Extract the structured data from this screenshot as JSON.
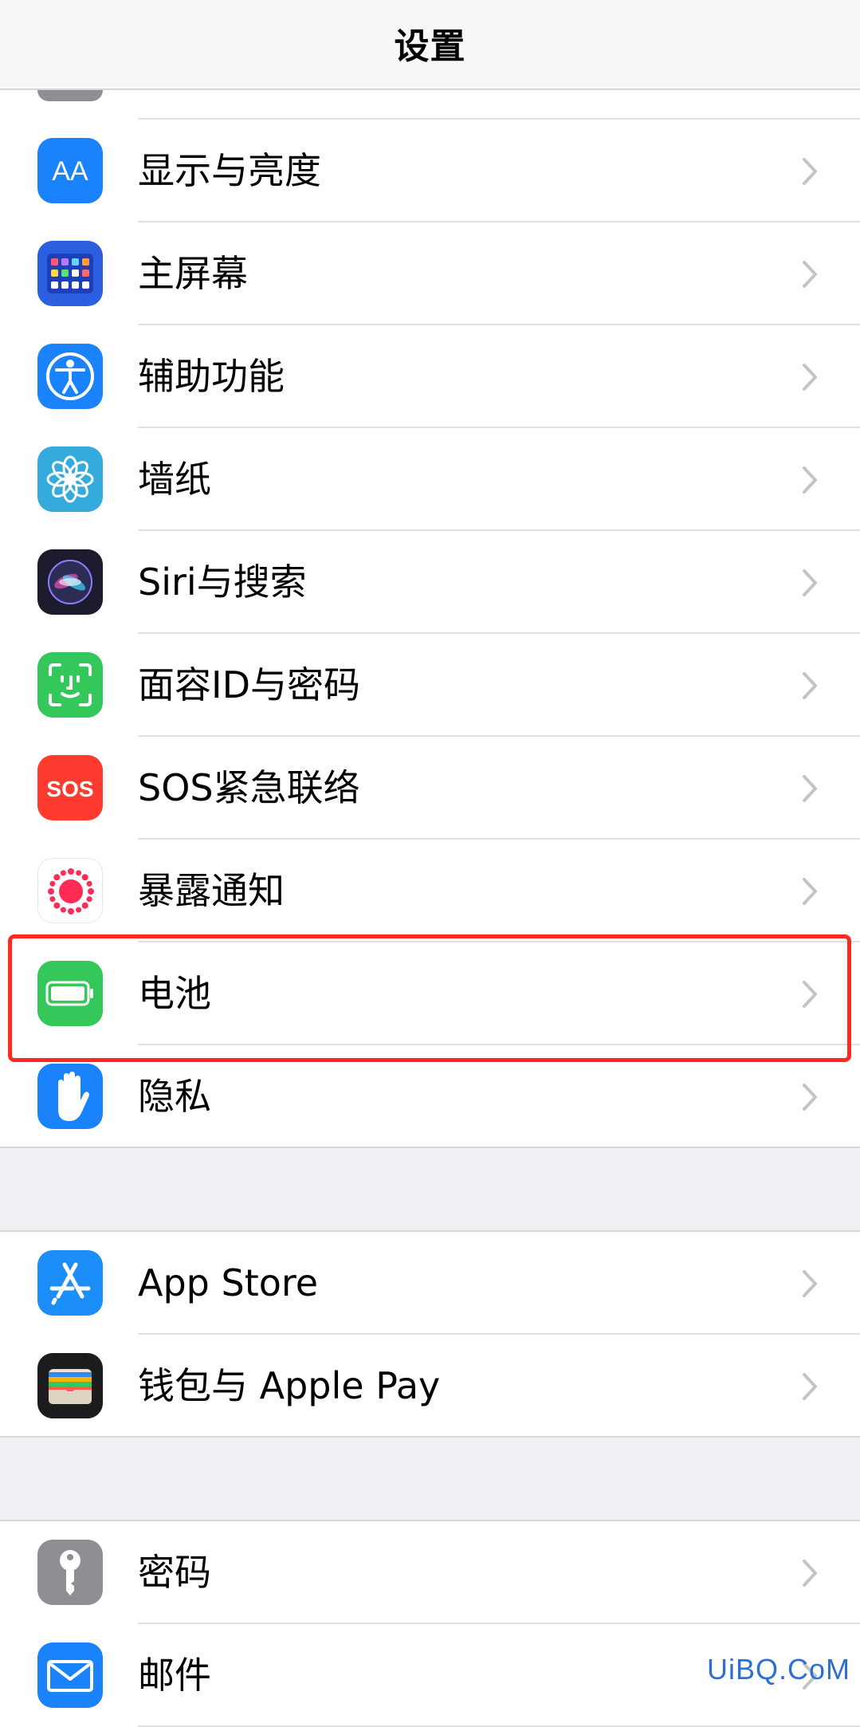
{
  "nav": {
    "title": "设置"
  },
  "groups": [
    {
      "rows": [
        {
          "label": "显示与亮度",
          "icon": "display-brightness-icon"
        },
        {
          "label": "主屏幕",
          "icon": "home-screen-icon"
        },
        {
          "label": "辅助功能",
          "icon": "accessibility-icon"
        },
        {
          "label": "墙纸",
          "icon": "wallpaper-icon"
        },
        {
          "label": "Siri与搜索",
          "icon": "siri-icon"
        },
        {
          "label": "面容ID与密码",
          "icon": "face-id-icon"
        },
        {
          "label": "SOS紧急联络",
          "icon": "sos-icon"
        },
        {
          "label": "暴露通知",
          "icon": "exposure-notification-icon"
        },
        {
          "label": "电池",
          "icon": "battery-icon"
        },
        {
          "label": "隐私",
          "icon": "privacy-hand-icon"
        }
      ]
    },
    {
      "rows": [
        {
          "label": "App Store",
          "icon": "app-store-icon"
        },
        {
          "label": "钱包与 Apple Pay",
          "icon": "wallet-icon"
        }
      ]
    },
    {
      "rows": [
        {
          "label": "密码",
          "icon": "passwords-key-icon"
        },
        {
          "label": "邮件",
          "icon": "mail-icon"
        }
      ]
    }
  ],
  "icon_text": {
    "aa": "AA",
    "sos": "SOS"
  },
  "highlight": {
    "target": "电池",
    "color": "#ff2a1f"
  },
  "watermark": "UiBQ.CoM",
  "colors": {
    "display": "#1a82fb",
    "home": "#2c5fe0",
    "accessibility": "#1a82fb",
    "wallpaper": "#35aadc",
    "siri": "#1c1c2e",
    "faceid": "#34c759",
    "sos": "#ff3b30",
    "battery": "#34c759",
    "privacy": "#1a82fb",
    "appstore": "#1c8ef9",
    "wallet": "#1c1c1e",
    "passwords": "#8e8e93",
    "mail": "#1a82fb",
    "chevron": "#c4c4c7",
    "group_gap": "#efeff4"
  }
}
